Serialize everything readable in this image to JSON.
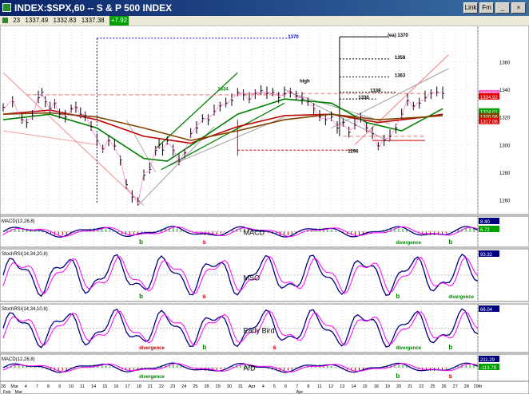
{
  "window": {
    "title": "INDEX:$SPX,60 -- S & P 500 INDEX",
    "buttons": [
      "Link",
      "Fm"
    ]
  },
  "quote": {
    "interval": "23",
    "high": "1337.49",
    "low": "1332.83",
    "last": "1337.38",
    "change": "+7.92"
  },
  "chart_data": {
    "type": "line",
    "title": "INDEX:$SPX,60 -- S & P 500 INDEX",
    "xlabel": "",
    "ylabel": "",
    "x_tick_labels": [
      "28",
      "Mar",
      "4",
      "7",
      "8",
      "9",
      "10",
      "11",
      "14",
      "15",
      "16",
      "17",
      "18",
      "21",
      "22",
      "23",
      "24",
      "25",
      "28",
      "29",
      "30",
      "31",
      "Apr",
      "4",
      "5",
      "6",
      "7",
      "8",
      "11",
      "12",
      "13",
      "14",
      "15",
      "18",
      "19",
      "20",
      "21",
      "22",
      "25",
      "26",
      "27",
      "28",
      "29th"
    ],
    "bottom_axis_labels": [
      "Feb",
      "Mar",
      "Apr"
    ],
    "ylim": [
      1250,
      1385
    ],
    "y_ticks": [
      1260,
      1280,
      1300,
      1320,
      1340,
      1360
    ],
    "price_markers": [
      {
        "label": "1337.20",
        "value": 1337.2,
        "color": "#ff66cc"
      },
      {
        "label": "1334.92",
        "value": 1334.9,
        "color": "#e00000"
      },
      {
        "label": "1324.01",
        "value": 1324.0,
        "color": "#00a000"
      },
      {
        "label": "1320.56",
        "value": 1320.6,
        "color": "#804000"
      },
      {
        "label": "1317.06",
        "value": 1317.1,
        "color": "#e00000"
      }
    ],
    "series": [
      {
        "name": "SPX 60-min",
        "color": "#000000",
        "x": [
          0,
          0.8,
          1.6,
          2,
          2.5,
          3,
          3.3,
          3.6,
          4,
          4.4,
          4.8,
          5.3,
          5.8,
          6.2,
          6.6,
          7,
          7.5,
          8,
          8.5,
          9,
          9.5,
          10,
          10.5,
          11,
          11.5,
          12,
          12.5,
          13,
          13.3,
          13.6,
          14,
          14.5,
          15,
          15.5,
          16,
          16.5,
          17,
          17.5,
          18,
          18.5,
          19,
          19.5,
          20,
          20.5,
          21,
          21.5,
          22,
          22.5,
          23,
          23.5,
          24,
          24.5,
          25,
          25.5,
          26,
          26.5,
          27,
          27.5,
          28,
          28.5,
          29,
          29.5,
          30,
          30.5,
          31,
          31.5,
          32,
          32.5,
          33,
          33.5,
          34,
          34.5,
          35,
          35.5,
          36,
          36.5,
          37,
          37.5
        ],
        "values": [
          1327,
          1331,
          1318,
          1316,
          1321,
          1334,
          1338,
          1331,
          1326,
          1330,
          1322,
          1320,
          1326,
          1327,
          1322,
          1321,
          1313,
          1303,
          1297,
          1303,
          1299,
          1289,
          1271,
          1262,
          1259,
          1278,
          1282,
          1296,
          1300,
          1296,
          1303,
          1296,
          1288,
          1294,
          1308,
          1312,
          1319,
          1318,
          1324,
          1328,
          1330,
          1332,
          1338,
          1336,
          1333,
          1337,
          1339,
          1337,
          1338,
          1334,
          1337,
          1338,
          1335,
          1333,
          1331,
          1326,
          1320,
          1318,
          1320,
          1312,
          1316,
          1309,
          1314,
          1320,
          1312,
          1308,
          1299,
          1303,
          1306,
          1312,
          1322,
          1332,
          1328,
          1330,
          1334,
          1337,
          1338,
          1337
        ]
      },
      {
        "name": "Moving average (red)",
        "color": "#c00000",
        "x": [
          0,
          4,
          8,
          12,
          16,
          20,
          24,
          28,
          32,
          36,
          37.5
        ],
        "values": [
          1322,
          1325,
          1318,
          1306,
          1301,
          1313,
          1321,
          1322,
          1316,
          1320,
          1322
        ]
      },
      {
        "name": "Moving average (green)",
        "color": "#008000",
        "x": [
          0,
          4,
          8,
          12,
          14,
          17,
          20,
          24,
          28,
          31,
          34,
          37.5
        ],
        "values": [
          1318,
          1322,
          1312,
          1290,
          1288,
          1305,
          1322,
          1333,
          1330,
          1316,
          1310,
          1326
        ]
      },
      {
        "name": "Moving average (brown)",
        "color": "#804000",
        "x": [
          0,
          4,
          8,
          12,
          16,
          20,
          24,
          28,
          32,
          36,
          37.5
        ],
        "values": [
          1322,
          1323,
          1320,
          1312,
          1303,
          1310,
          1318,
          1322,
          1318,
          1320,
          1321
        ]
      }
    ],
    "annotations": [
      {
        "text": "1370",
        "x": 24.3,
        "y": 1377,
        "color": "#0000cc"
      },
      {
        "text": "1334",
        "x": 18.3,
        "y": 1339,
        "color": "#008000"
      },
      {
        "text": "high",
        "x": 25.3,
        "y": 1345,
        "color": "#000000"
      },
      {
        "text": "(ea) 1370",
        "x": 32.8,
        "y": 1378,
        "color": "#000000"
      },
      {
        "text": "1358",
        "x": 33.4,
        "y": 1362,
        "color": "#000000"
      },
      {
        "text": "1363",
        "x": 33.4,
        "y": 1349,
        "color": "#000000"
      },
      {
        "text": "1339",
        "x": 31.3,
        "y": 1338,
        "color": "#000000"
      },
      {
        "text": "1330",
        "x": 30.3,
        "y": 1333,
        "color": "#000000"
      },
      {
        "text": "1296",
        "x": 29.4,
        "y": 1294,
        "color": "#000000"
      }
    ],
    "indicators": [
      {
        "name": "MACD(12,26,8)",
        "label": "MACD",
        "readouts": [
          "8.40",
          "6.72"
        ],
        "annotations": [
          "b",
          "divergence",
          "b",
          "s"
        ]
      },
      {
        "name": "StochRSI(14,34,20,8)",
        "label": "MSO",
        "readouts": [
          "93.32"
        ],
        "annotations": [
          "b",
          "b",
          "divergence",
          "s"
        ]
      },
      {
        "name": "StochRSI(14,34,10,8)",
        "label": "Early Bird",
        "readouts": [
          "66.04"
        ],
        "annotations": [
          "divergence",
          "divergence",
          "b",
          "b",
          "s"
        ]
      },
      {
        "name": "MACD(12,26,8)",
        "label": "A/D",
        "readouts": [
          "211.29",
          "-113.79"
        ],
        "annotations": [
          "divergence",
          "b",
          "s"
        ]
      }
    ]
  }
}
